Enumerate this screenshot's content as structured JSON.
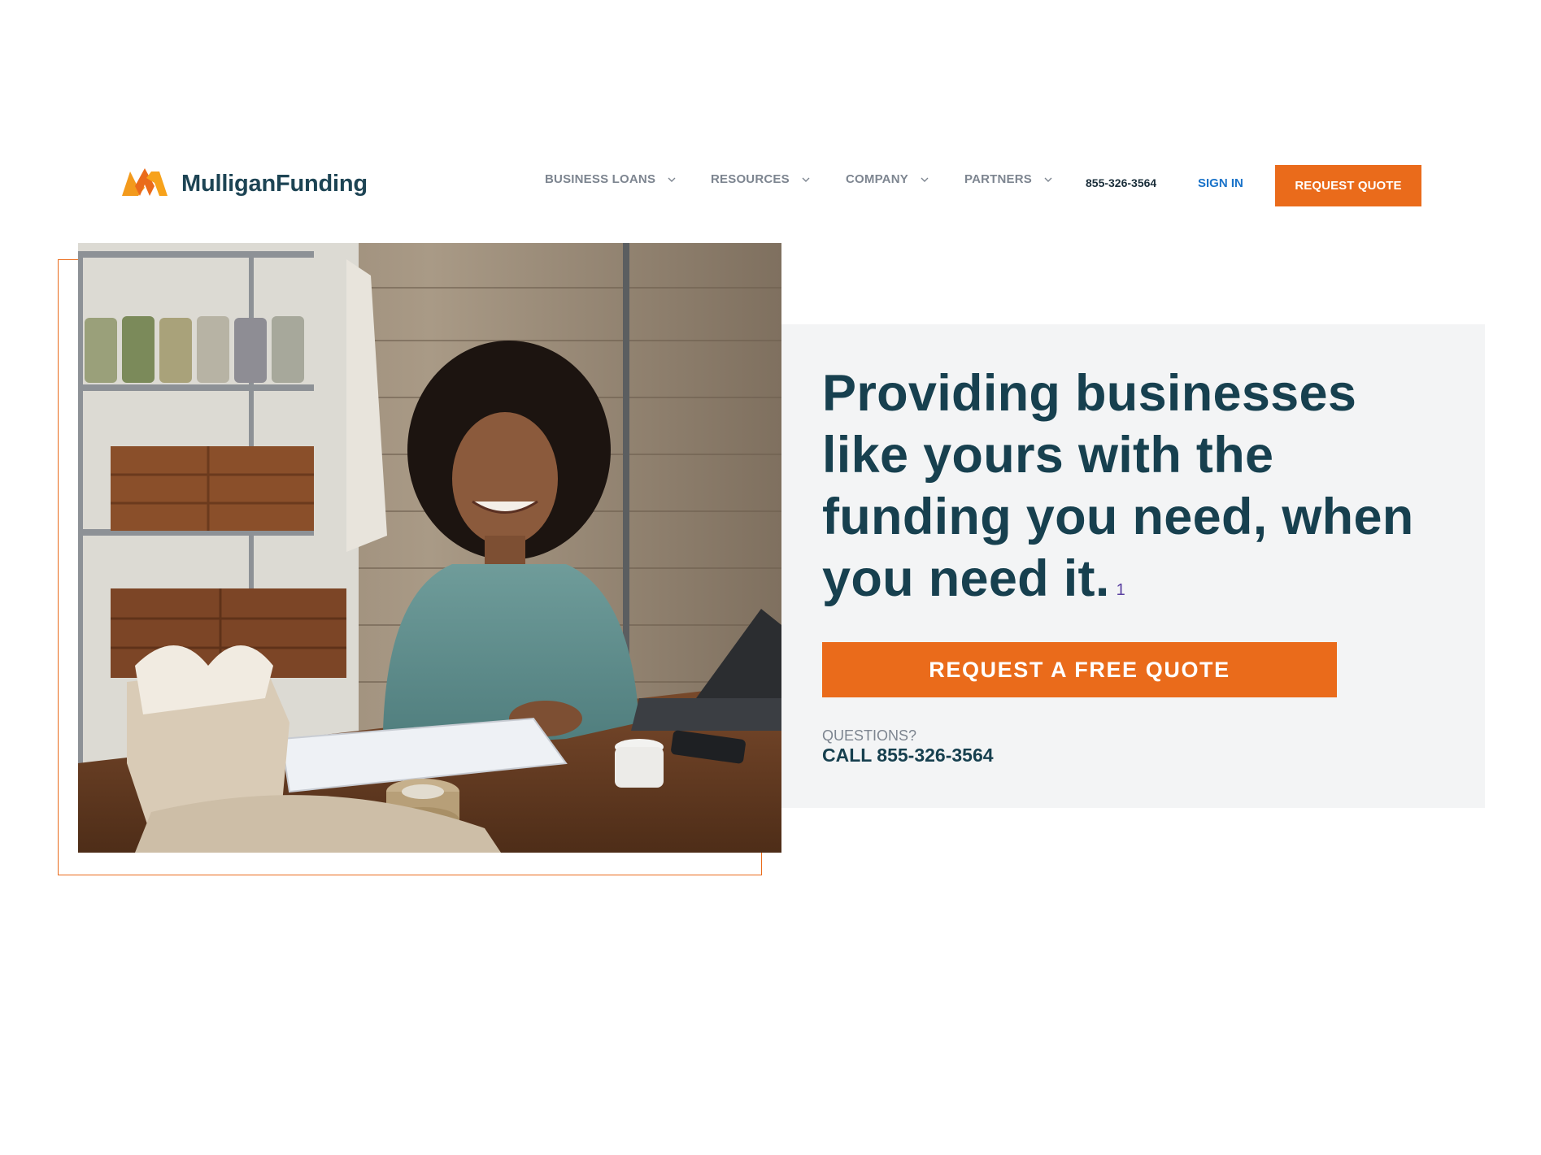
{
  "header": {
    "logo_text": "MulliganFunding",
    "nav": [
      {
        "label": "BUSINESS LOANS"
      },
      {
        "label": "RESOURCES"
      },
      {
        "label": "COMPANY"
      },
      {
        "label": "PARTNERS"
      }
    ],
    "phone": "855-326-3564",
    "sign_in": "SIGN IN",
    "request_quote": "REQUEST QUOTE"
  },
  "hero": {
    "title": "Providing businesses like yours with the funding you need, when you need it.",
    "footnote": "1",
    "cta": "REQUEST A FREE QUOTE",
    "questions": "QUESTIONS?",
    "call": "CALL 855-326-3564",
    "image_alt": "Smiling small business owner at her desk with shipping boxes and a tablet"
  },
  "colors": {
    "accent": "#ea6b1b",
    "heading": "#17404f",
    "panel_bg": "#f3f4f5",
    "link": "#1a73c9"
  },
  "icons": {
    "logo": "mulligan-m-logo-icon",
    "nav_chevron": "chevron-down-icon"
  }
}
